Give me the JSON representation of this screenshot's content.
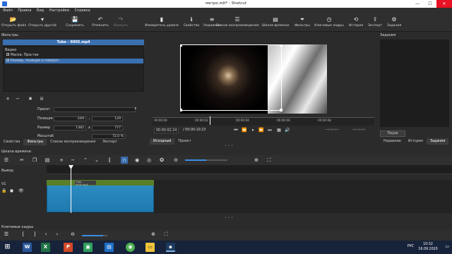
{
  "window": {
    "title": "метро.mlt* - Shotcut"
  },
  "menu": [
    "Файл",
    "Правка",
    "Вид",
    "Настройки",
    "Справка"
  ],
  "toolbar": {
    "left": [
      {
        "label": "Открыть файл",
        "icon": "open-folder-icon",
        "glyph": "📂"
      },
      {
        "label": "Открыть другой",
        "icon": "open-other-icon",
        "glyph": "▾"
      },
      {
        "label": "Сохранить",
        "icon": "save-icon",
        "glyph": "💾"
      },
      {
        "label": "Отменить",
        "icon": "undo-icon",
        "glyph": "↶"
      },
      {
        "label": "Вернуть",
        "icon": "redo-icon",
        "glyph": "↷"
      }
    ],
    "right": [
      {
        "label": "Измеритель уровня",
        "icon": "audio-meter-icon",
        "glyph": "▮"
      },
      {
        "label": "Свойства",
        "icon": "properties-icon",
        "glyph": "ℹ"
      },
      {
        "label": "Недавние",
        "icon": "recent-icon",
        "glyph": "≡"
      },
      {
        "label": "Список воспроизведения",
        "icon": "playlist-icon",
        "glyph": "☰"
      },
      {
        "label": "Шкала времени",
        "icon": "timeline-icon",
        "glyph": "▤"
      },
      {
        "label": "Фильтры",
        "icon": "filters-icon",
        "glyph": "⏷"
      },
      {
        "label": "Ключевые кадры",
        "icon": "keyframes-icon",
        "glyph": "◷"
      },
      {
        "label": "История",
        "icon": "history-icon",
        "glyph": "⟲"
      },
      {
        "label": "Экспорт",
        "icon": "export-icon",
        "glyph": "⇪"
      },
      {
        "label": "Задания",
        "icon": "jobs-icon",
        "glyph": "⚙"
      }
    ]
  },
  "filters": {
    "header": "Фильтры",
    "clip_name": "Tube - 9005.mp4",
    "section_label": "Видео",
    "items": [
      {
        "label": "Маска: Простая",
        "checked": true,
        "selected": false
      },
      {
        "label": "Размер, позиция и поворот",
        "checked": true,
        "selected": true
      }
    ],
    "preset_label": "Пресет",
    "position_label": "Позиция",
    "position_x": "-169",
    "position_sep": ",",
    "position_y": "129",
    "size_label": "Размер",
    "size_w": "1382",
    "size_x_sep": "x",
    "size_h": "777",
    "scale_label": "Масштаб",
    "scale_value": "72,0 %"
  },
  "left_tabs": [
    "Свойства",
    "Фильтры",
    "Список воспроизведения",
    "Экспорт"
  ],
  "player": {
    "ruler_ticks": [
      "00:00:00",
      "00:00:02",
      "00:00:04",
      "00:00:06",
      "00:00:08"
    ],
    "current_time": "00:00:02:24",
    "total_time": "/ 00:00:10:23",
    "in_point": "--:--:--:--",
    "out_point": "--:--:--:--",
    "tabs": [
      "Исходный",
      "Проект"
    ]
  },
  "right_panel": {
    "header": "Задания",
    "pause_label": "Пауза",
    "tabs": [
      "Недавние",
      "История",
      "Задания"
    ]
  },
  "timeline": {
    "title": "Шкала времени",
    "output_label": "Вывод",
    "track_label": "V1",
    "clip_name": "Tube - 9005.mp4"
  },
  "keyframes": {
    "title": "Ключевые кадры"
  },
  "taskbar": {
    "lang": "РУС",
    "time": "10:32",
    "date": "16.09.2020"
  }
}
